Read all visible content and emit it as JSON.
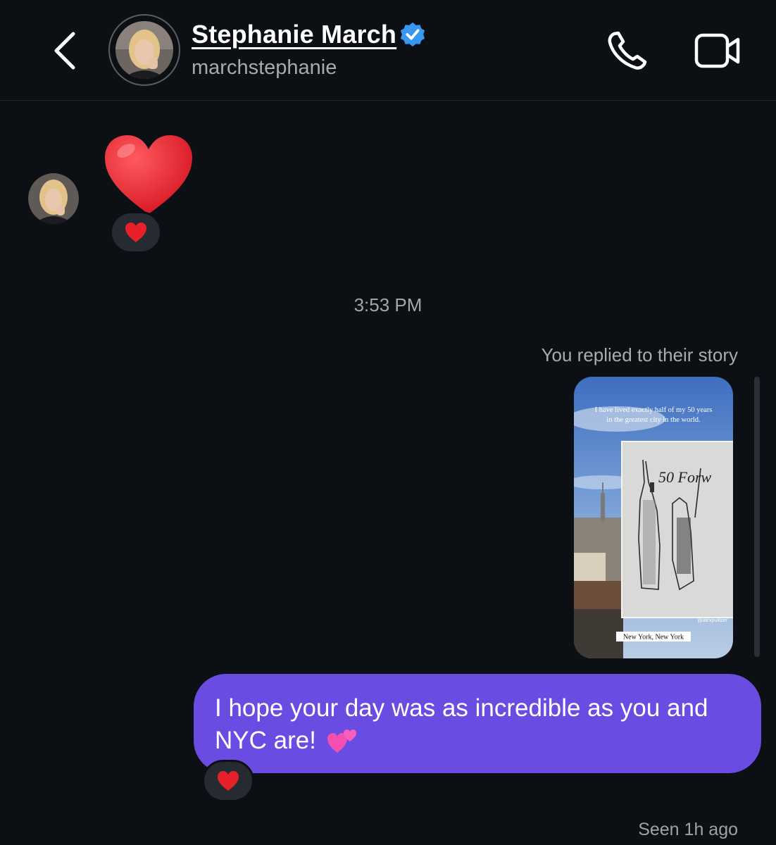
{
  "header": {
    "contact_name": "Stephanie March",
    "handle": "marchstephanie",
    "verified": true,
    "back_icon": "chevron-left-icon",
    "call_icon": "phone-icon",
    "video_icon": "video-camera-icon"
  },
  "thread": {
    "incoming_message": {
      "content": "heart-emoji",
      "reaction": "heart-emoji"
    },
    "timestamp": "3:53 PM",
    "story_reply_label": "You replied to their story",
    "story": {
      "caption": "I have lived exactly half of my 50 years in the greatest city in the world.",
      "card_title": "50 Forw",
      "credit": "@alexpulitzer",
      "location_tag": "New York, New York"
    },
    "outgoing_message": {
      "text": "I hope your day was as incredible as you and NYC are!",
      "emoji": "two-hearts-emoji",
      "reaction": "heart-emoji"
    },
    "seen_status": "Seen 1h ago"
  },
  "colors": {
    "background": "#0c0f14",
    "bubble_outgoing": "#6a4ce3",
    "verified_badge": "#3897f0",
    "heart": "#e8202a",
    "reaction_pill": "#262a31"
  }
}
